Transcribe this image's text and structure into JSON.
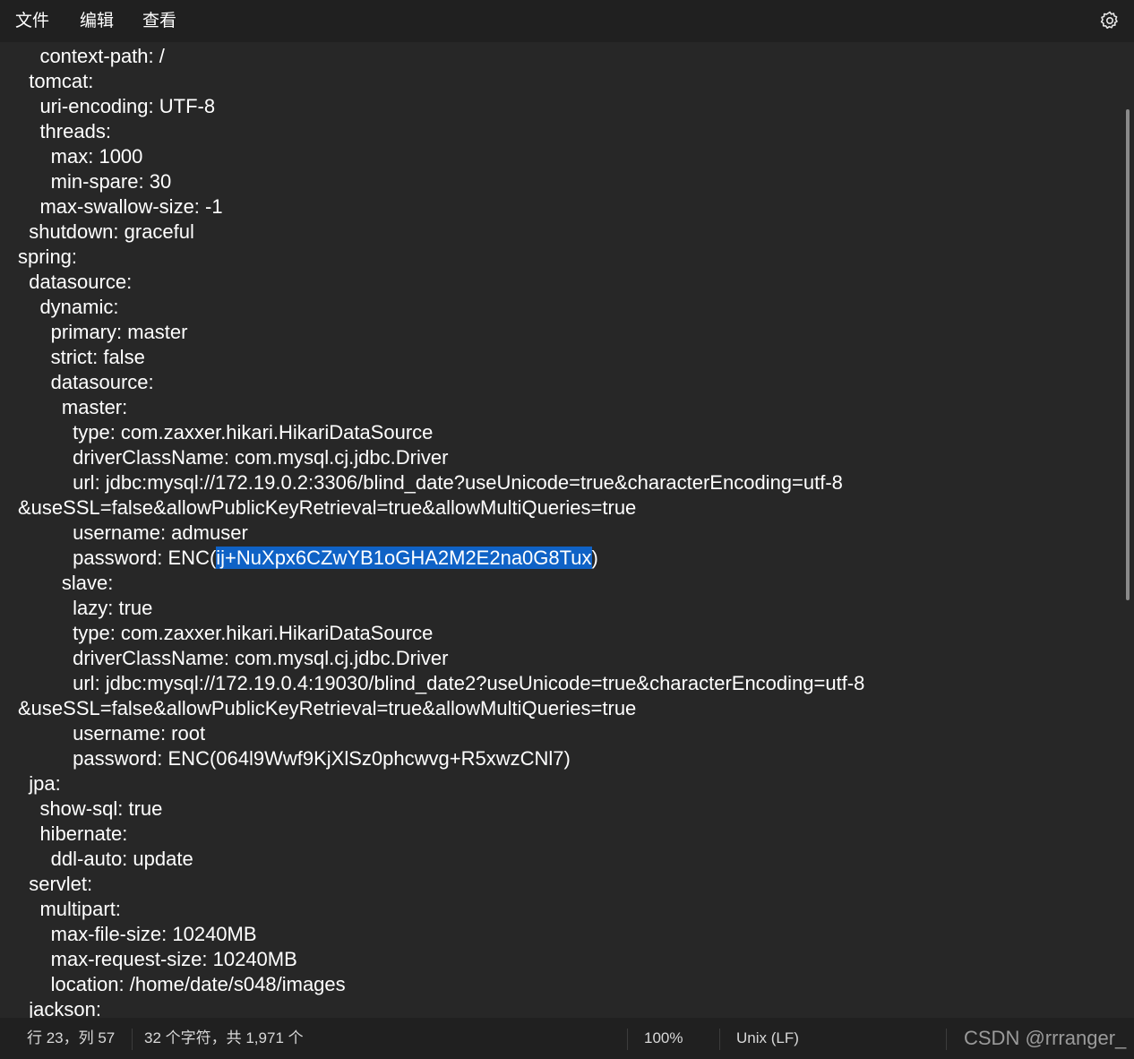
{
  "menu": {
    "file": "文件",
    "edit": "编辑",
    "view": "查看"
  },
  "icons": {
    "settings": "gear-icon"
  },
  "lines": [
    "    context-path: /",
    "  tomcat:",
    "    uri-encoding: UTF-8",
    "    threads:",
    "      max: 1000",
    "      min-spare: 30",
    "    max-swallow-size: -1",
    "  shutdown: graceful",
    "spring:",
    "  datasource:",
    "    dynamic:",
    "      primary: master",
    "      strict: false",
    "      datasource:",
    "        master:",
    "          type: com.zaxxer.hikari.HikariDataSource",
    "          driverClassName: com.mysql.cj.jdbc.Driver",
    "          url: jdbc:mysql://172.19.0.2:3306/blind_date?useUnicode=true&characterEncoding=utf-8",
    "&useSSL=false&allowPublicKeyRetrieval=true&allowMultiQueries=true",
    "          username: admuser",
    {
      "before": "          password: ENC(",
      "selected": "ij+NuXpx6CZwYB1oGHA2M2E2na0G8Tux",
      "after": ")"
    },
    "        slave:",
    "          lazy: true",
    "          type: com.zaxxer.hikari.HikariDataSource",
    "          driverClassName: com.mysql.cj.jdbc.Driver",
    "          url: jdbc:mysql://172.19.0.4:19030/blind_date2?useUnicode=true&characterEncoding=utf-8",
    "&useSSL=false&allowPublicKeyRetrieval=true&allowMultiQueries=true",
    "          username: root",
    "          password: ENC(064l9Wwf9KjXlSz0phcwvg+R5xwzCNl7)",
    "  jpa:",
    "    show-sql: true",
    "    hibernate:",
    "      ddl-auto: update",
    "  servlet:",
    "    multipart:",
    "      max-file-size: 10240MB",
    "      max-request-size: 10240MB",
    "      location: /home/date/s048/images",
    "  jackson:"
  ],
  "status": {
    "position": "行 23，列 57",
    "selection": "32 个字符，共 1,971 个",
    "zoom": "100%",
    "line_ending": "Unix (LF)",
    "watermark": "CSDN @rrranger_"
  },
  "colors": {
    "background": "#272727",
    "menubar": "#202020",
    "selection": "#0f62c6",
    "text": "#ffffff"
  }
}
